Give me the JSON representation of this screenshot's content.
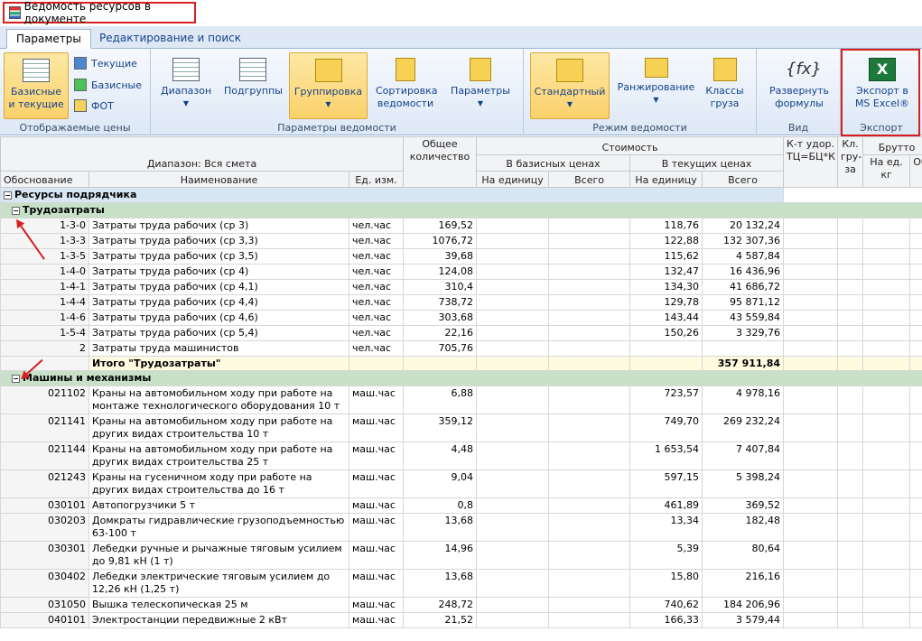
{
  "title": "Ведомость ресурсов в документе",
  "tabs": [
    "Параметры",
    "Редактирование и поиск"
  ],
  "ribbon": {
    "prices_group": {
      "label": "Отображаемые цены",
      "base_current": "Базисные и текущие",
      "current": "Текущие",
      "base": "Базисные",
      "fot": "ФОТ"
    },
    "params_group": {
      "label": "Параметры ведомости",
      "range": "Диапазон",
      "subgroups": "Подгруппы",
      "grouping": "Группировка",
      "sort": "Сортировка ведомости",
      "params": "Параметры"
    },
    "mode_group": {
      "label": "Режим ведомости",
      "standard": "Стандартный",
      "ranking": "Ранжирование",
      "cargo_classes": "Классы груза"
    },
    "view_group": {
      "label": "Вид",
      "expand": "Развернуть формулы"
    },
    "export_group": {
      "label": "Экспорт",
      "excel": "Экспорт в MS Excel®"
    }
  },
  "headers": {
    "range": "Диапазон: Вся смета",
    "basis": "Обоснование",
    "name": "Наименование",
    "unit": "Ед. изм.",
    "qty": "Общее количество",
    "cost": "Стоимость",
    "base_prices": "В базисных ценах",
    "cur_prices": "В текущих ценах",
    "per_unit": "На единицу",
    "total": "Всего",
    "coef": "К-т удор. ТЦ=БЦ*К",
    "cls": "Кл. гру- за",
    "gross": "Брутто",
    "per_kg": "На ед. кг",
    "o": "Об"
  },
  "groups": {
    "contractor": "Ресурсы подрядчика",
    "labor": "Трудозатраты",
    "machines": "Машины и механизмы"
  },
  "labor_rows": [
    [
      "1-3-0",
      "Затраты труда рабочих (ср 3)",
      "чел.час",
      "169,52",
      "118,76",
      "20 132,24"
    ],
    [
      "1-3-3",
      "Затраты труда рабочих (ср 3,3)",
      "чел.час",
      "1076,72",
      "122,88",
      "132 307,36"
    ],
    [
      "1-3-5",
      "Затраты труда рабочих (ср 3,5)",
      "чел.час",
      "39,68",
      "115,62",
      "4 587,84"
    ],
    [
      "1-4-0",
      "Затраты труда рабочих (ср 4)",
      "чел.час",
      "124,08",
      "132,47",
      "16 436,96"
    ],
    [
      "1-4-1",
      "Затраты труда рабочих (ср 4,1)",
      "чел.час",
      "310,4",
      "134,30",
      "41 686,72"
    ],
    [
      "1-4-4",
      "Затраты труда рабочих (ср 4,4)",
      "чел.час",
      "738,72",
      "129,78",
      "95 871,12"
    ],
    [
      "1-4-6",
      "Затраты труда рабочих (ср 4,6)",
      "чел.час",
      "303,68",
      "143,44",
      "43 559,84"
    ],
    [
      "1-5-4",
      "Затраты труда рабочих (ср 5,4)",
      "чел.час",
      "22,16",
      "150,26",
      "3 329,76"
    ],
    [
      "2",
      "Затраты труда машинистов",
      "чел.час",
      "705,76",
      "",
      ""
    ]
  ],
  "labor_total": {
    "label": "Итого \"Трудозатраты\"",
    "value": "357 911,84"
  },
  "machine_rows": [
    [
      "021102",
      "Краны на автомобильном ходу при работе на монтаже технологического оборудования 10 т",
      "маш.час",
      "6,88",
      "723,57",
      "4 978,16"
    ],
    [
      "021141",
      "Краны на автомобильном ходу при работе на других видах строительства 10 т",
      "маш.час",
      "359,12",
      "749,70",
      "269 232,24"
    ],
    [
      "021144",
      "Краны на автомобильном ходу при работе на других видах строительства 25 т",
      "маш.час",
      "4,48",
      "1 653,54",
      "7 407,84"
    ],
    [
      "021243",
      "Краны на гусеничном ходу при работе на других видах строительства до 16 т",
      "маш.час",
      "9,04",
      "597,15",
      "5 398,24"
    ],
    [
      "030101",
      "Автопогрузчики 5 т",
      "маш.час",
      "0,8",
      "461,89",
      "369,52"
    ],
    [
      "030203",
      "Домкраты гидравлические грузоподъемностью 63-100 т",
      "маш.час",
      "13,68",
      "13,34",
      "182,48"
    ],
    [
      "030301",
      "Лебедки ручные и рычажные тяговым усилием до 9,81 кН (1 т)",
      "маш.час",
      "14,96",
      "5,39",
      "80,64"
    ],
    [
      "030402",
      "Лебедки электрические тяговым усилием до 12,26 кН (1,25 т)",
      "маш.час",
      "13,68",
      "15,80",
      "216,16"
    ],
    [
      "031050",
      "Вышка телескопическая 25 м",
      "маш.час",
      "248,72",
      "740,62",
      "184 206,96"
    ],
    [
      "040101",
      "Электростанции передвижные 2 кВт",
      "маш.час",
      "21,52",
      "166,33",
      "3 579,44"
    ]
  ]
}
